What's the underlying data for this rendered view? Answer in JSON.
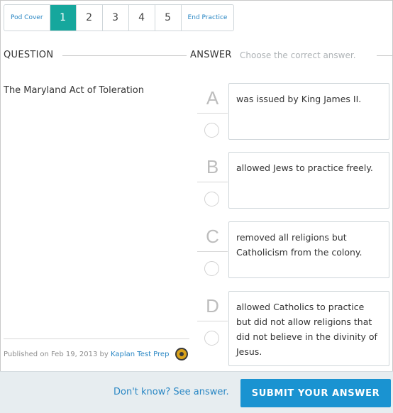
{
  "nav": {
    "pod_cover": "Pod Cover",
    "pages": [
      "1",
      "2",
      "3",
      "4",
      "5"
    ],
    "active_page": "1",
    "end_practice": "End Practice"
  },
  "question_header": "QUESTION",
  "answer_header": "ANSWER",
  "answer_instruction": "Choose the correct answer.",
  "question_text": "The Maryland Act of Toleration",
  "options": [
    {
      "letter": "A",
      "text": "was issued by King James II."
    },
    {
      "letter": "B",
      "text": "allowed Jews to practice freely."
    },
    {
      "letter": "C",
      "text": "removed all religions but Catholicism from the colony."
    },
    {
      "letter": "D",
      "text": "allowed Catholics to practice but did not allow religions that did not believe in the divinity of Jesus."
    }
  ],
  "published": {
    "prefix": "Published on Feb 19, 2013 by",
    "author": "Kaplan Test Prep",
    "badge_icon": "author-badge-icon"
  },
  "footer": {
    "dont_know": "Don't know? See answer.",
    "submit": "SUBMIT YOUR ANSWER"
  },
  "colors": {
    "active_page": "#16a79d",
    "link": "#2a87c4",
    "submit": "#1a93d1",
    "footer_bg": "#e7edf0"
  }
}
